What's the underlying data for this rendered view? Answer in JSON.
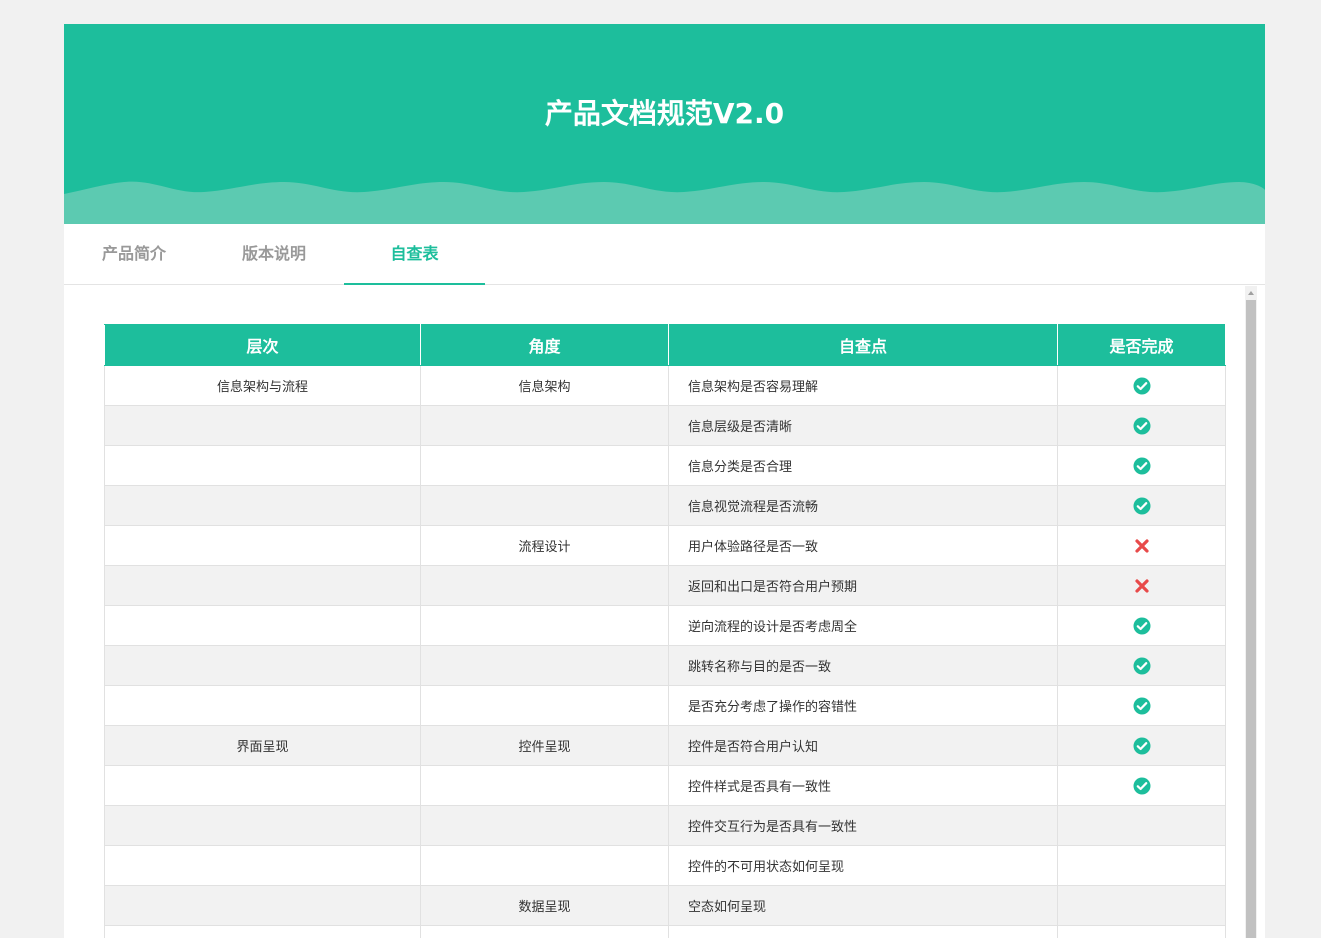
{
  "header": {
    "title": "产品文档规范V2.0"
  },
  "tabs": [
    {
      "label": "产品简介",
      "active": false
    },
    {
      "label": "版本说明",
      "active": false
    },
    {
      "label": "自查表",
      "active": true
    }
  ],
  "colors": {
    "accent": "#1dbe9c",
    "wave": "#5ccab1",
    "check": "#1dbe9c",
    "cross": "#e84a4a"
  },
  "table": {
    "columns": [
      "层次",
      "角度",
      "自查点",
      "是否完成"
    ],
    "rows": [
      {
        "level": "信息架构与流程",
        "angle": "信息架构",
        "point": "信息架构是否容易理解",
        "status": "done"
      },
      {
        "level": "",
        "angle": "",
        "point": "信息层级是否清晰",
        "status": "done"
      },
      {
        "level": "",
        "angle": "",
        "point": "信息分类是否合理",
        "status": "done"
      },
      {
        "level": "",
        "angle": "",
        "point": "信息视觉流程是否流畅",
        "status": "done"
      },
      {
        "level": "",
        "angle": "流程设计",
        "point": "用户体验路径是否一致",
        "status": "fail"
      },
      {
        "level": "",
        "angle": "",
        "point": "返回和出口是否符合用户预期",
        "status": "fail"
      },
      {
        "level": "",
        "angle": "",
        "point": "逆向流程的设计是否考虑周全",
        "status": "done"
      },
      {
        "level": "",
        "angle": "",
        "point": "跳转名称与目的是否一致",
        "status": "done"
      },
      {
        "level": "",
        "angle": "",
        "point": "是否充分考虑了操作的容错性",
        "status": "done"
      },
      {
        "level": "界面呈现",
        "angle": "控件呈现",
        "point": "控件是否符合用户认知",
        "status": "done"
      },
      {
        "level": "",
        "angle": "",
        "point": "控件样式是否具有一致性",
        "status": "done"
      },
      {
        "level": "",
        "angle": "",
        "point": "控件交互行为是否具有一致性",
        "status": ""
      },
      {
        "level": "",
        "angle": "",
        "point": "控件的不可用状态如何呈现",
        "status": ""
      },
      {
        "level": "",
        "angle": "数据呈现",
        "point": "空态如何呈现",
        "status": ""
      },
      {
        "level": "",
        "angle": "",
        "point": "",
        "status": ""
      }
    ]
  }
}
